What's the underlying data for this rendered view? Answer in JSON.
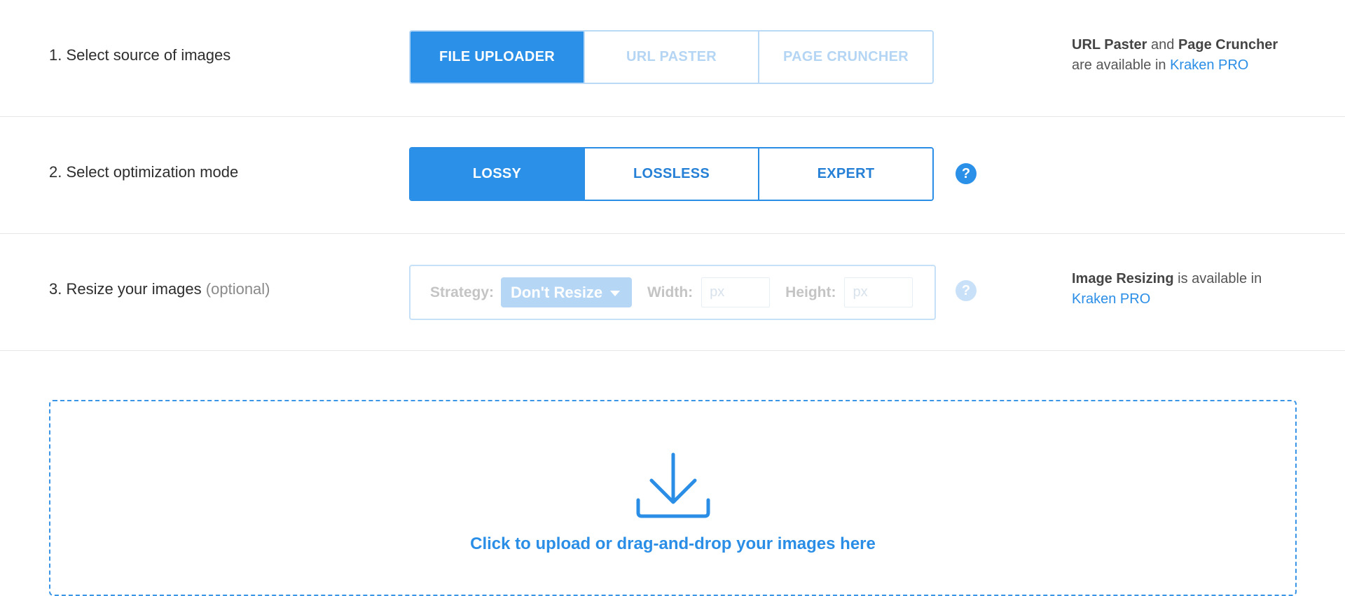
{
  "source": {
    "label": "1. Select source of images",
    "options": [
      "FILE UPLOADER",
      "URL PASTER",
      "PAGE CRUNCHER"
    ],
    "selected": "FILE UPLOADER",
    "note": {
      "part1": "URL Paster",
      "part2": " and ",
      "part3": "Page Cruncher",
      "part4": "are available in ",
      "link": "Kraken PRO"
    }
  },
  "mode": {
    "label": "2. Select optimization mode",
    "options": [
      "LOSSY",
      "LOSSLESS",
      "EXPERT"
    ],
    "selected": "LOSSY"
  },
  "resize": {
    "label": "3. Resize your images",
    "optional": "(optional)",
    "strategy_label": "Strategy:",
    "strategy_value": "Don't Resize",
    "width_label": "Width:",
    "width_placeholder": "px",
    "height_label": "Height:",
    "height_placeholder": "px",
    "note": {
      "part1": "Image Resizing",
      "part2": " is available in",
      "link": "Kraken PRO"
    }
  },
  "help_glyph": "?",
  "dropzone": {
    "text": "Click to upload or drag-and-drop your images here"
  },
  "colors": {
    "accent": "#2b90e8",
    "accent_faded": "#b6d6f6"
  }
}
